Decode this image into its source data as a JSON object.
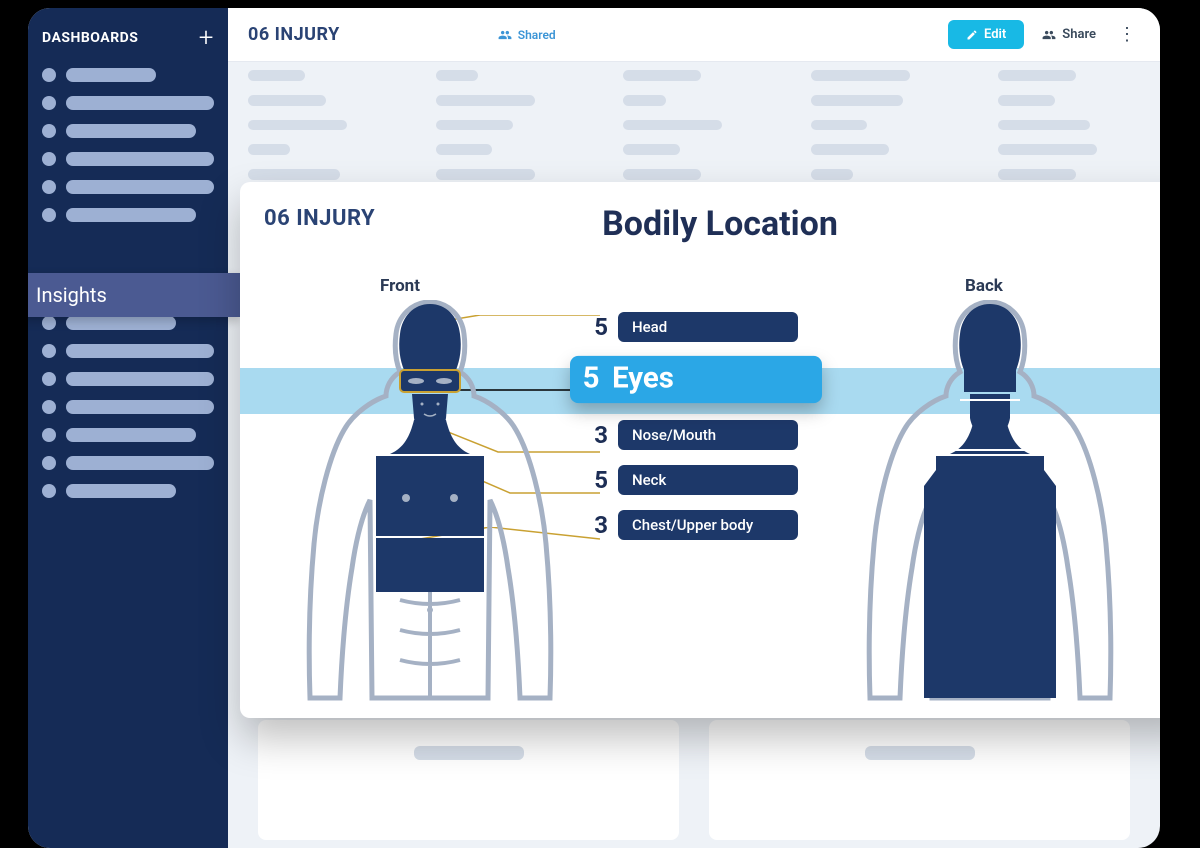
{
  "sidebar": {
    "title": "DASHBOARDS",
    "insights_label": "Insights"
  },
  "header": {
    "title": "06 INJURY",
    "shared_label": "Shared",
    "edit_label": "Edit",
    "share_label": "Share"
  },
  "card": {
    "small_title": "06 INJURY",
    "big_title": "Bodily Location",
    "front_label": "Front",
    "back_label": "Back",
    "legend": [
      {
        "count": "5",
        "label": "Head",
        "highlight": false
      },
      {
        "count": "5",
        "label": "Eyes",
        "highlight": true
      },
      {
        "count": "3",
        "label": "Nose/Mouth",
        "highlight": false
      },
      {
        "count": "5",
        "label": "Neck",
        "highlight": false
      },
      {
        "count": "3",
        "label": "Chest/Upper body",
        "highlight": false
      }
    ]
  },
  "colors": {
    "navy": "#1D3869",
    "accent": "#2BA7E6",
    "strip": "#A9DAF0",
    "sidebar": "#152B56"
  },
  "chart_data": {
    "type": "table",
    "title": "Bodily Location",
    "views": [
      "Front",
      "Back"
    ],
    "categories": [
      "Head",
      "Eyes",
      "Nose/Mouth",
      "Neck",
      "Chest/Upper body"
    ],
    "values": [
      5,
      5,
      3,
      5,
      3
    ],
    "highlighted_category": "Eyes"
  }
}
